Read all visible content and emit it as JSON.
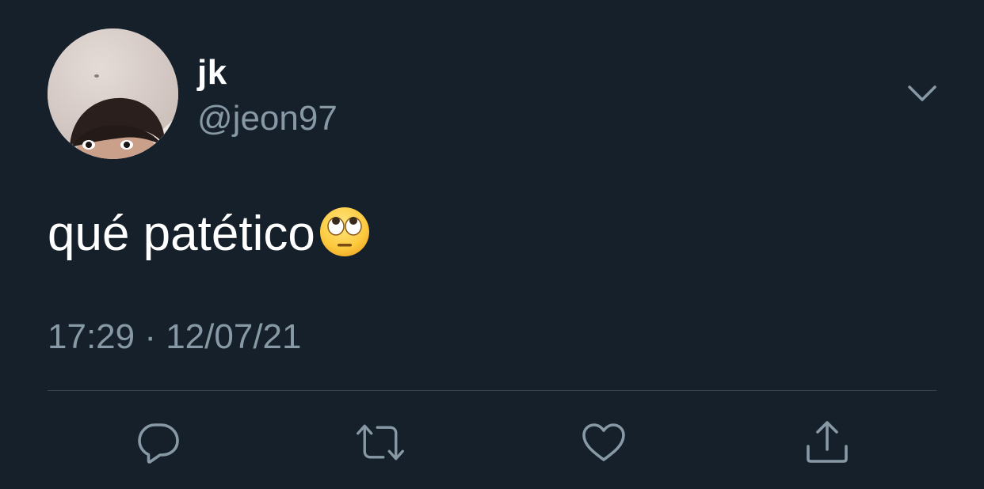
{
  "theme": {
    "background": "#15202b",
    "primary_text": "#ffffff",
    "secondary_text": "#8899a6",
    "divider": "#38444d",
    "icon_color": "#8899a6"
  },
  "author": {
    "display_name": "jk",
    "handle": "@jeon97",
    "avatar_icon": "profile-photo"
  },
  "tweet": {
    "text": "qué patético",
    "emoji": "face-with-rolling-eyes",
    "timestamp": "17:29 · 12/07/21"
  },
  "header": {
    "more_icon": "chevron-down-icon"
  },
  "actions": [
    {
      "name": "reply",
      "icon": "speech-bubble-icon"
    },
    {
      "name": "retweet",
      "icon": "retweet-icon"
    },
    {
      "name": "like",
      "icon": "heart-icon"
    },
    {
      "name": "share",
      "icon": "share-upload-icon"
    }
  ]
}
